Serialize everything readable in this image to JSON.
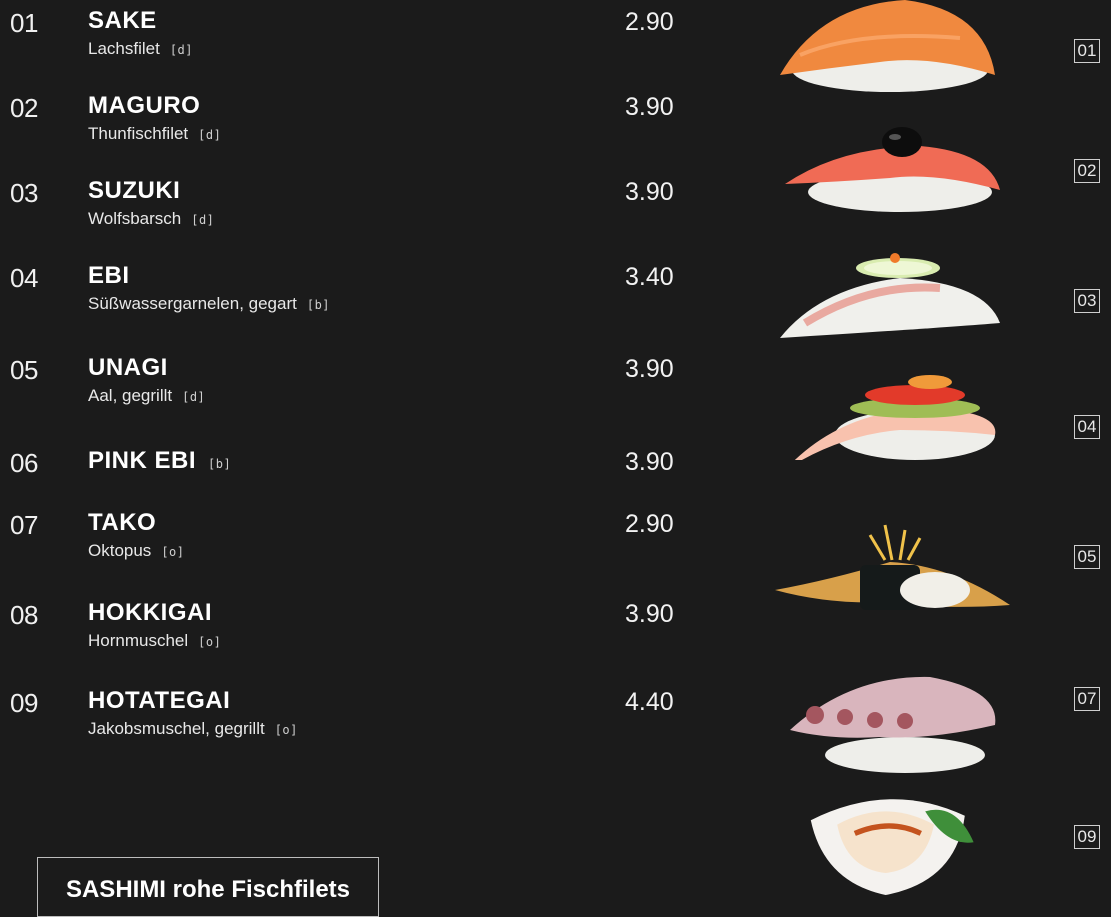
{
  "menu": {
    "items": [
      {
        "num": "01",
        "name": "SAKE",
        "name_tag": "",
        "desc": "Lachsfilet",
        "tag": "[d]",
        "price": "2.90"
      },
      {
        "num": "02",
        "name": "MAGURO",
        "name_tag": "",
        "desc": "Thunfischfilet",
        "tag": "[d]",
        "price": "3.90"
      },
      {
        "num": "03",
        "name": "SUZUKI",
        "name_tag": "",
        "desc": "Wolfsbarsch",
        "tag": "[d]",
        "price": "3.90"
      },
      {
        "num": "04",
        "name": "EBI",
        "name_tag": "",
        "desc": "Süßwassergarnelen, gegart",
        "tag": "[b]",
        "price": "3.40"
      },
      {
        "num": "05",
        "name": "UNAGI",
        "name_tag": "",
        "desc": "Aal, gegrillt",
        "tag": "[d]",
        "price": "3.90"
      },
      {
        "num": "06",
        "name": "PINK EBI",
        "name_tag": "[b]",
        "desc": "",
        "tag": "",
        "price": "3.90"
      },
      {
        "num": "07",
        "name": "TAKO",
        "name_tag": "",
        "desc": "Oktopus",
        "tag": "[o]",
        "price": "2.90"
      },
      {
        "num": "08",
        "name": "HOKKIGAI",
        "name_tag": "",
        "desc": "Hornmuschel",
        "tag": "[o]",
        "price": "3.90"
      },
      {
        "num": "09",
        "name": "HOTATEGAI",
        "name_tag": "",
        "desc": "Jakobsmuschel, gegrillt",
        "tag": "[o]",
        "price": "4.40"
      }
    ]
  },
  "footer": {
    "label": "SASHIMI rohe Fischfilets"
  },
  "image_labels": [
    "01",
    "02",
    "03",
    "04",
    "05",
    "07",
    "09"
  ],
  "colors": {
    "background": "#1b1b1b",
    "text": "#ffffff",
    "rice": "#f2f2ee",
    "salmon": "#f08a4a"
  }
}
